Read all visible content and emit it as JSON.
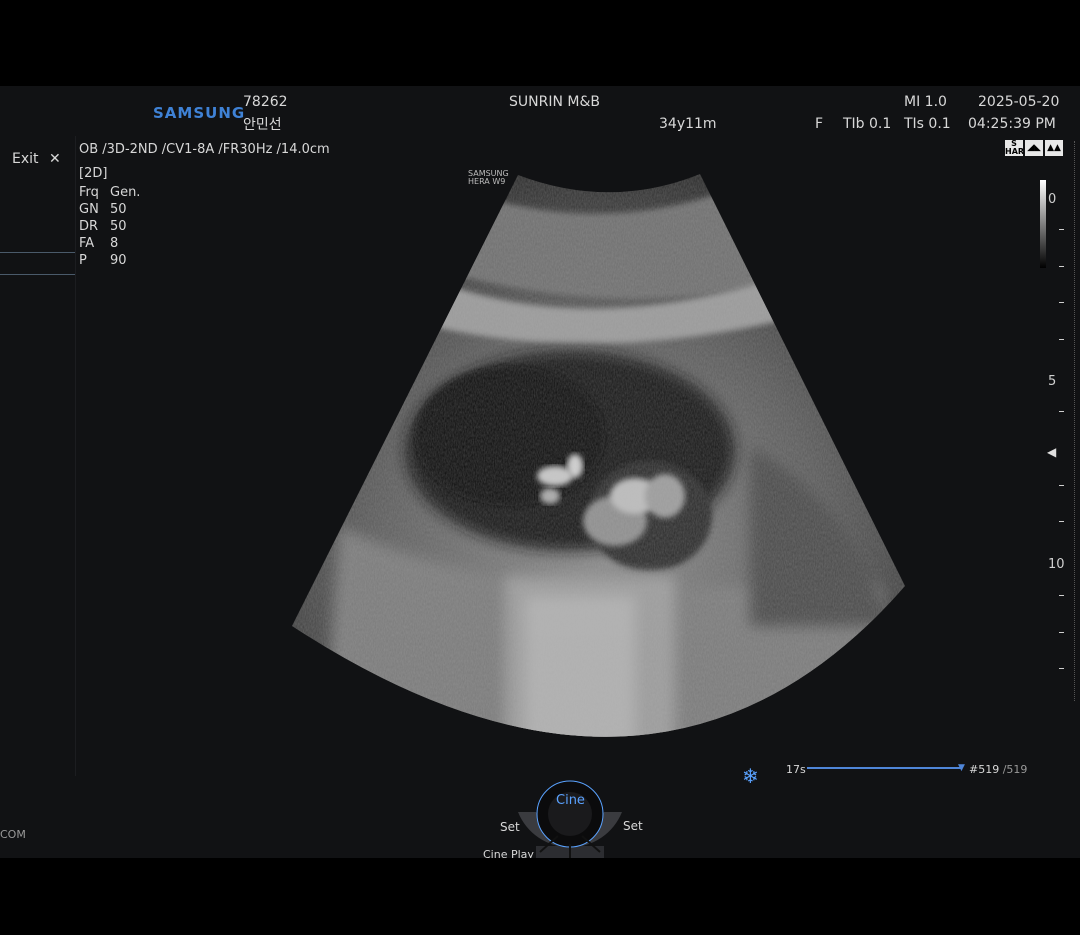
{
  "header": {
    "brand": "SAMSUNG",
    "patient_id": "78262",
    "patient_name": "안민선",
    "institution": "SUNRIN M&B",
    "age": "34y11m",
    "mi": "MI 1.0",
    "date": "2025-05-20",
    "focus": "F",
    "tib": "TIb 0.1",
    "tis": "TIs 0.1",
    "time": "04:25:39 PM"
  },
  "exit_label": "Exit",
  "probe_info": "OB /3D-2ND /CV1-8A /FR30Hz /14.0cm",
  "mode_label": "[2D]",
  "params": [
    {
      "name": "Frq",
      "value": "Gen."
    },
    {
      "name": "GN",
      "value": "50"
    },
    {
      "name": "DR",
      "value": "50"
    },
    {
      "name": "FA",
      "value": "8"
    },
    {
      "name": "P",
      "value": "90"
    }
  ],
  "watermark": {
    "line1": "SAMSUNG",
    "line2": "HERA W9"
  },
  "depth_scale": {
    "labels": [
      "0",
      "5",
      "10"
    ]
  },
  "cine": {
    "time": "17s",
    "frame": "#519",
    "total": "/519",
    "button": "Cine",
    "set_left": "Set",
    "set_right": "Set",
    "play_label": "Cine Play"
  },
  "freeze_icon": "snowflake-icon",
  "status_icons": [
    "S HAR",
    "probe-icon",
    "person-icon"
  ],
  "bottom_left_text": "COM",
  "colors": {
    "brand": "#3f82d6",
    "cine_accent": "#5aa2ff",
    "cine_bar": "#4f86d8"
  }
}
